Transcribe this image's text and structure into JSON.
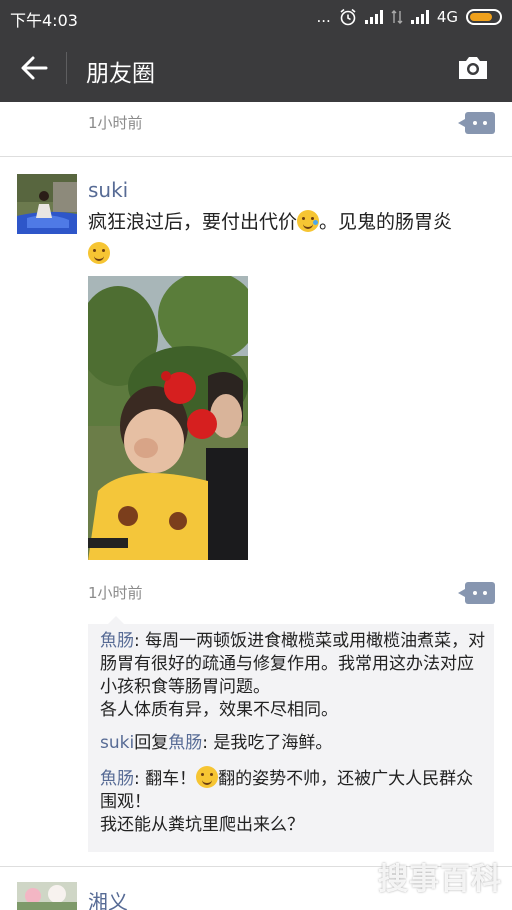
{
  "status_bar": {
    "time": "下午4:03",
    "dots": "...",
    "network": "4G"
  },
  "nav": {
    "title": "朋友圈"
  },
  "prev_post": {
    "time": "1小时前"
  },
  "post": {
    "user": "suki",
    "text_part1": "疯狂浪过后，要付出代价",
    "text_part2": "。见鬼的肠胃炎",
    "time": "1小时前"
  },
  "comments": [
    {
      "name": "魚肠",
      "sep": ": ",
      "text": "每周一两顿饭进食橄榄菜或用橄榄油煮菜，对肠胃有很好的疏通与修复作用。我常用这办法对应小孩积食等肠胃问题。\n各人体质有异，效果不尽相同。"
    },
    {
      "name": "suki",
      "reply_word": "回复",
      "reply_to": "魚肠",
      "sep": ": ",
      "text": "是我吃了海鲜。"
    },
    {
      "name": "魚肠",
      "sep": ": ",
      "text_part1": "翻车！",
      "text_part2": "翻的姿势不帅，还被广大人民群众围观！\n我还能从粪坑里爬出来么？"
    }
  ],
  "next_post": {
    "user": "湘义"
  },
  "watermark": "搜事百科",
  "colors": {
    "bar": "#3b3b3d",
    "link": "#576b95",
    "battery": "#f0a11c",
    "comment_bg": "#f3f3f5"
  }
}
